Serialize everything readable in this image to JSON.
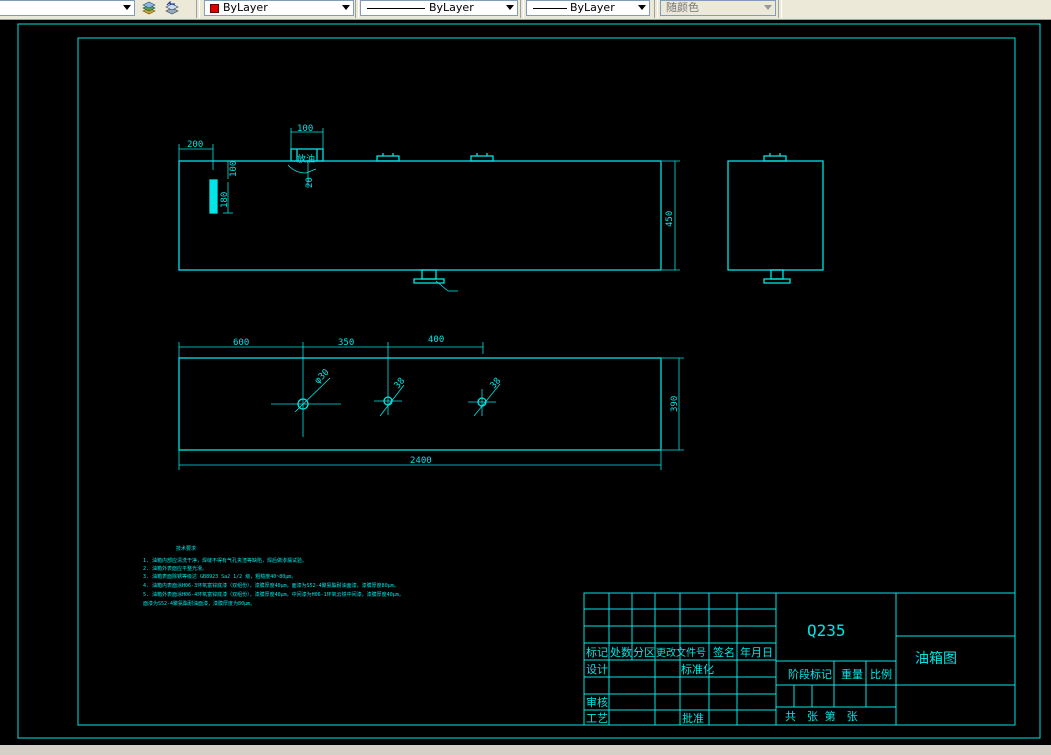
{
  "toolbar": {
    "color_control": "ByLayer",
    "linetype_control": "ByLayer",
    "lineweight_control": "ByLayer",
    "plotstyle_control": "随颜色"
  },
  "colors": {
    "background": "#000000",
    "cad_cyan": "#00e5e5",
    "layer_red": "#e00000"
  },
  "icons": [
    "dropdown-arrow-icon",
    "layer-states-icon",
    "layer-previous-icon"
  ],
  "drawing": {
    "front_view": {
      "dims": [
        "200",
        "100",
        "20",
        "100",
        "180",
        "450"
      ],
      "callout": "放油"
    },
    "plan_view": {
      "dims": [
        "600",
        "350",
        "400",
        "390",
        "2400"
      ],
      "holes": [
        "φ30",
        "38",
        "38"
      ]
    },
    "tech_notes": {
      "title": "技术要求",
      "lines": [
        "1. 油箱内部应清洗干净，焊缝不得有气孔夹渣等缺陷，焊后做渗漏试验。",
        "2. 油箱外表面应平整光滑。",
        "3. 油箱表面除锈等级达 GB8923 Sa2 1/2 级，粗糙度40~80μm。",
        "4. 油箱内表面涂H06-3环氧富锌底漆（双组份），漆膜厚度40μm，面漆为S52-4聚氨酯耐油面漆，漆膜厚度80μm。",
        "5. 油箱外表面涂H06-4环氧富锌底漆（双组份），漆膜厚度40μm，中间漆为H06-1环氧云铁中间漆，漆膜厚度40μm，",
        "   面漆为S52-4聚氨酯耐油面漆，漆膜厚度为80μm。"
      ]
    },
    "title_block": {
      "material": "Q235",
      "drawing_name": "油箱图",
      "headers": [
        "标记",
        "处数",
        "分区",
        "更改文件号",
        "签名",
        "年月日"
      ],
      "row_design": "设计",
      "row_standard": "标准化",
      "row_check": "审核",
      "row_process": "工艺",
      "row_approve": "批准",
      "stage_label": "阶段标记",
      "weight_label": "重量",
      "scale_label": "比例",
      "sheets": "共　张 第　张"
    }
  }
}
